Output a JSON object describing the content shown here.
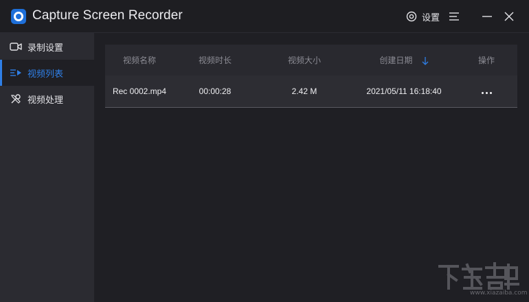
{
  "app": {
    "title": "Capture Screen Recorder",
    "accent_color": "#2f7fe6"
  },
  "titlebar": {
    "settings_label": "设置",
    "settings_icon": "gear-icon",
    "menu_icon": "hamburger-icon",
    "minimize_icon": "minimize-icon",
    "close_icon": "close-icon"
  },
  "sidebar": {
    "items": [
      {
        "label": "录制设置",
        "icon": "camera-icon",
        "active": false
      },
      {
        "label": "视频列表",
        "icon": "list-icon",
        "active": true
      },
      {
        "label": "视频处理",
        "icon": "tools-icon",
        "active": false
      }
    ]
  },
  "table": {
    "headers": {
      "name": "视频名称",
      "duration": "视频时长",
      "size": "视频大小",
      "date": "创建日期",
      "actions": "操作"
    },
    "sort": {
      "column": "date",
      "direction": "descending"
    },
    "rows": [
      {
        "name": "Rec 0002.mp4",
        "duration": "00:00:28",
        "size": "2.42 M",
        "date": "2021/05/11 16:18:40",
        "actions_icon": "more-icon"
      }
    ]
  },
  "watermark": {
    "text": "www.xiazaiba.com"
  }
}
